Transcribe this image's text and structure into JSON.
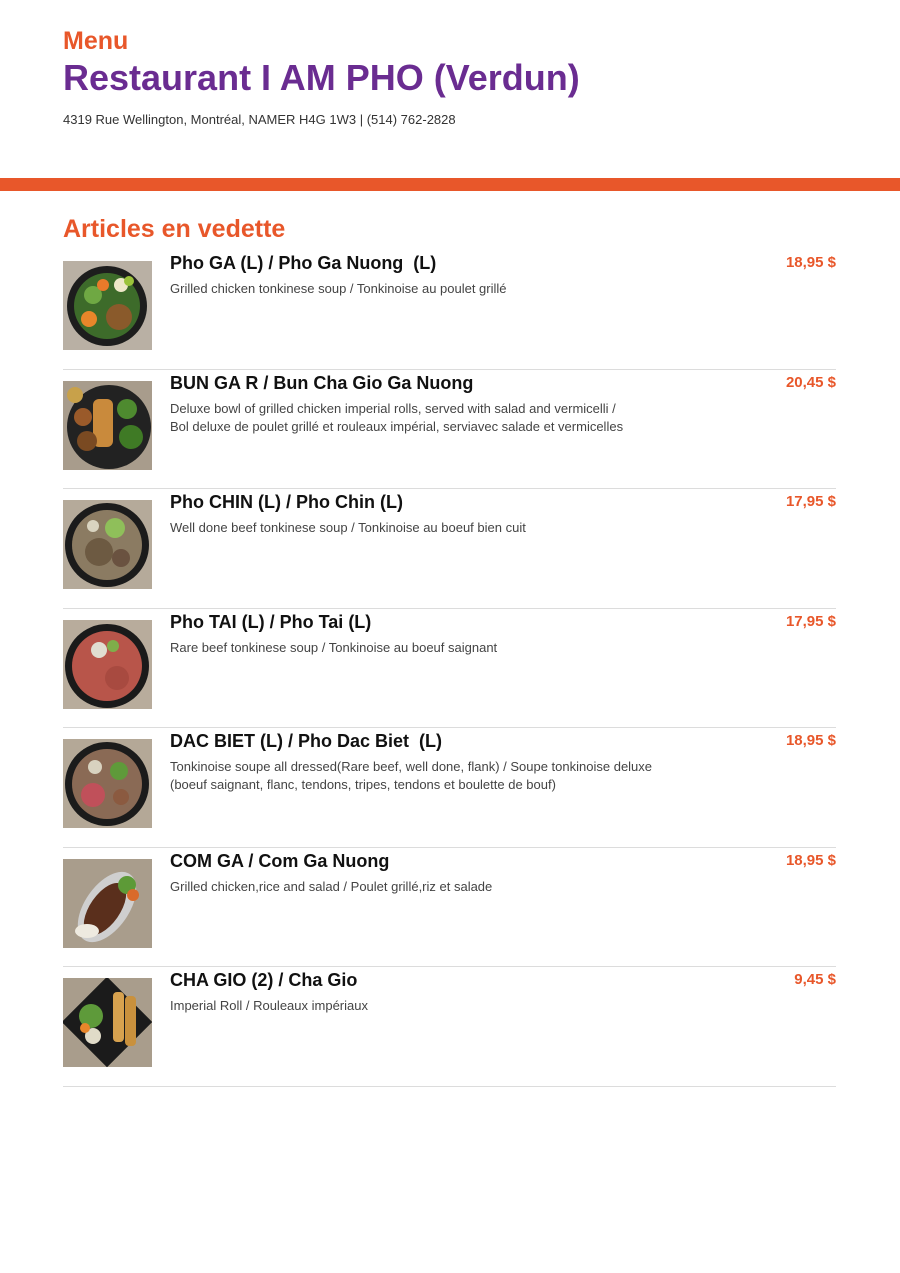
{
  "header": {
    "menu_label": "Menu",
    "restaurant_name": "Restaurant I AM PHO (Verdun)",
    "address": "4319 Rue Wellington, Montréal, NAMER H4G 1W3 | (514) 762-2828"
  },
  "colors": {
    "accent": "#e8572a",
    "brand": "#6a2c91",
    "divider": "#dcdcdc"
  },
  "section": {
    "title": "Articles en vedette"
  },
  "items": [
    {
      "name": "Pho GA (L) / Pho Ga Nuong  (L)",
      "price": "18,95 $",
      "desc": [
        "Grilled chicken tonkinese soup / Tonkinoise au poulet grillé"
      ],
      "image": "pho-ga-photo"
    },
    {
      "name": "BUN GA R / Bun Cha Gio Ga Nuong",
      "price": "20,45 $",
      "desc": [
        "Deluxe bowl of grilled chicken imperial rolls, served with salad and vermicelli /",
        "Bol deluxe de poulet grillé et rouleaux impérial, serviavec salade et vermicelles"
      ],
      "image": "bun-ga-photo"
    },
    {
      "name": "Pho CHIN (L) / Pho Chin (L)",
      "price": "17,95 $",
      "desc": [
        "Well done beef tonkinese soup / Tonkinoise au boeuf bien cuit"
      ],
      "image": "pho-chin-photo"
    },
    {
      "name": "Pho TAI (L) / Pho Tai (L)",
      "price": "17,95 $",
      "desc": [
        "Rare beef tonkinese soup / Tonkinoise au boeuf saignant"
      ],
      "image": "pho-tai-photo"
    },
    {
      "name": "DAC BIET (L) / Pho Dac Biet  (L)",
      "price": "18,95 $",
      "desc": [
        "Tonkinoise soupe all dressed(Rare beef, well done, flank) / Soupe tonkinoise deluxe",
        "(boeuf saignant, flanc, tendons, tripes, tendons et boulette de bouf)"
      ],
      "image": "dac-biet-photo"
    },
    {
      "name": "COM GA / Com Ga Nuong",
      "price": "18,95 $",
      "desc": [
        "Grilled chicken,rice and salad / Poulet grillé,riz et salade"
      ],
      "image": "com-ga-photo"
    },
    {
      "name": "CHA GIO (2) / Cha Gio",
      "price": "9,45 $",
      "desc": [
        "Imperial Roll / Rouleaux impériaux"
      ],
      "image": "cha-gio-photo"
    }
  ]
}
